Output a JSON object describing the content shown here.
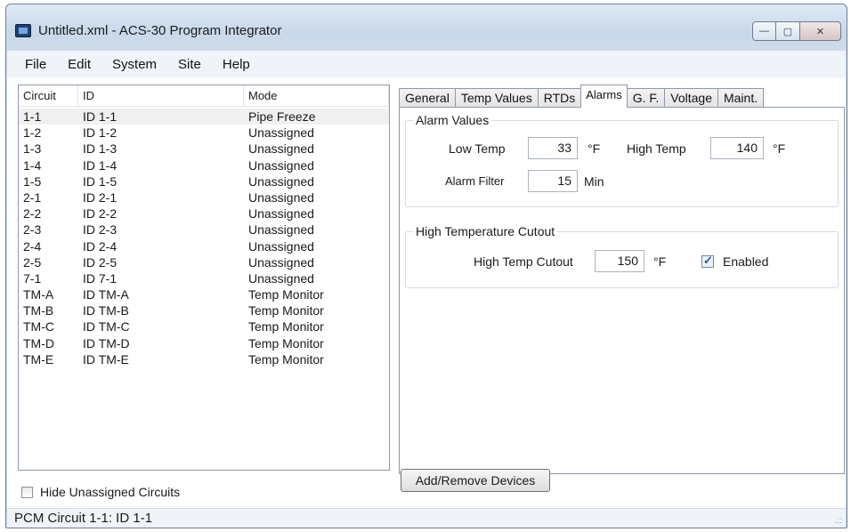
{
  "window": {
    "title": "Untitled.xml - ACS-30 Program Integrator",
    "min_glyph": "—",
    "max_glyph": "▢",
    "close_glyph": "✕"
  },
  "menu": [
    "File",
    "Edit",
    "System",
    "Site",
    "Help"
  ],
  "circuit_list": {
    "headers": {
      "circuit": "Circuit",
      "id": "ID",
      "mode": "Mode"
    },
    "rows": [
      {
        "circuit": "1-1",
        "id": "ID 1-1",
        "mode": "Pipe Freeze"
      },
      {
        "circuit": "1-2",
        "id": "ID 1-2",
        "mode": "Unassigned"
      },
      {
        "circuit": "1-3",
        "id": "ID 1-3",
        "mode": "Unassigned"
      },
      {
        "circuit": "1-4",
        "id": "ID 1-4",
        "mode": "Unassigned"
      },
      {
        "circuit": "1-5",
        "id": "ID 1-5",
        "mode": "Unassigned"
      },
      {
        "circuit": "2-1",
        "id": "ID 2-1",
        "mode": "Unassigned"
      },
      {
        "circuit": "2-2",
        "id": "ID 2-2",
        "mode": "Unassigned"
      },
      {
        "circuit": "2-3",
        "id": "ID 2-3",
        "mode": "Unassigned"
      },
      {
        "circuit": "2-4",
        "id": "ID 2-4",
        "mode": "Unassigned"
      },
      {
        "circuit": "2-5",
        "id": "ID 2-5",
        "mode": "Unassigned"
      },
      {
        "circuit": "7-1",
        "id": "ID 7-1",
        "mode": "Unassigned"
      },
      {
        "circuit": "TM-A",
        "id": "ID TM-A",
        "mode": "Temp Monitor"
      },
      {
        "circuit": "TM-B",
        "id": "ID TM-B",
        "mode": "Temp Monitor"
      },
      {
        "circuit": "TM-C",
        "id": "ID TM-C",
        "mode": "Temp Monitor"
      },
      {
        "circuit": "TM-D",
        "id": "ID TM-D",
        "mode": "Temp Monitor"
      },
      {
        "circuit": "TM-E",
        "id": "ID TM-E",
        "mode": "Temp Monitor"
      }
    ]
  },
  "hide_unassigned": {
    "label": "Hide Unassigned Circuits",
    "checked": false
  },
  "tabs": {
    "general": "General",
    "temp_values": "Temp Values",
    "rtds": "RTDs",
    "alarms": "Alarms",
    "gf": "G. F.",
    "voltage": "Voltage",
    "maint": "Maint."
  },
  "alarm_values": {
    "title": "Alarm Values",
    "low_temp_label": "Low Temp",
    "low_temp_value": "33",
    "low_temp_unit": "°F",
    "high_temp_label": "High Temp",
    "high_temp_value": "140",
    "high_temp_unit": "°F",
    "alarm_filter_label": "Alarm Filter",
    "alarm_filter_value": "15",
    "alarm_filter_unit": "Min"
  },
  "cutout": {
    "title": "High Temperature Cutout",
    "label": "High Temp Cutout",
    "value": "150",
    "unit": "°F",
    "enabled_label": "Enabled",
    "enabled_checked": true
  },
  "add_remove_button": "Add/Remove Devices",
  "status": "PCM Circuit 1-1: ID 1-1",
  "grip": ".::"
}
